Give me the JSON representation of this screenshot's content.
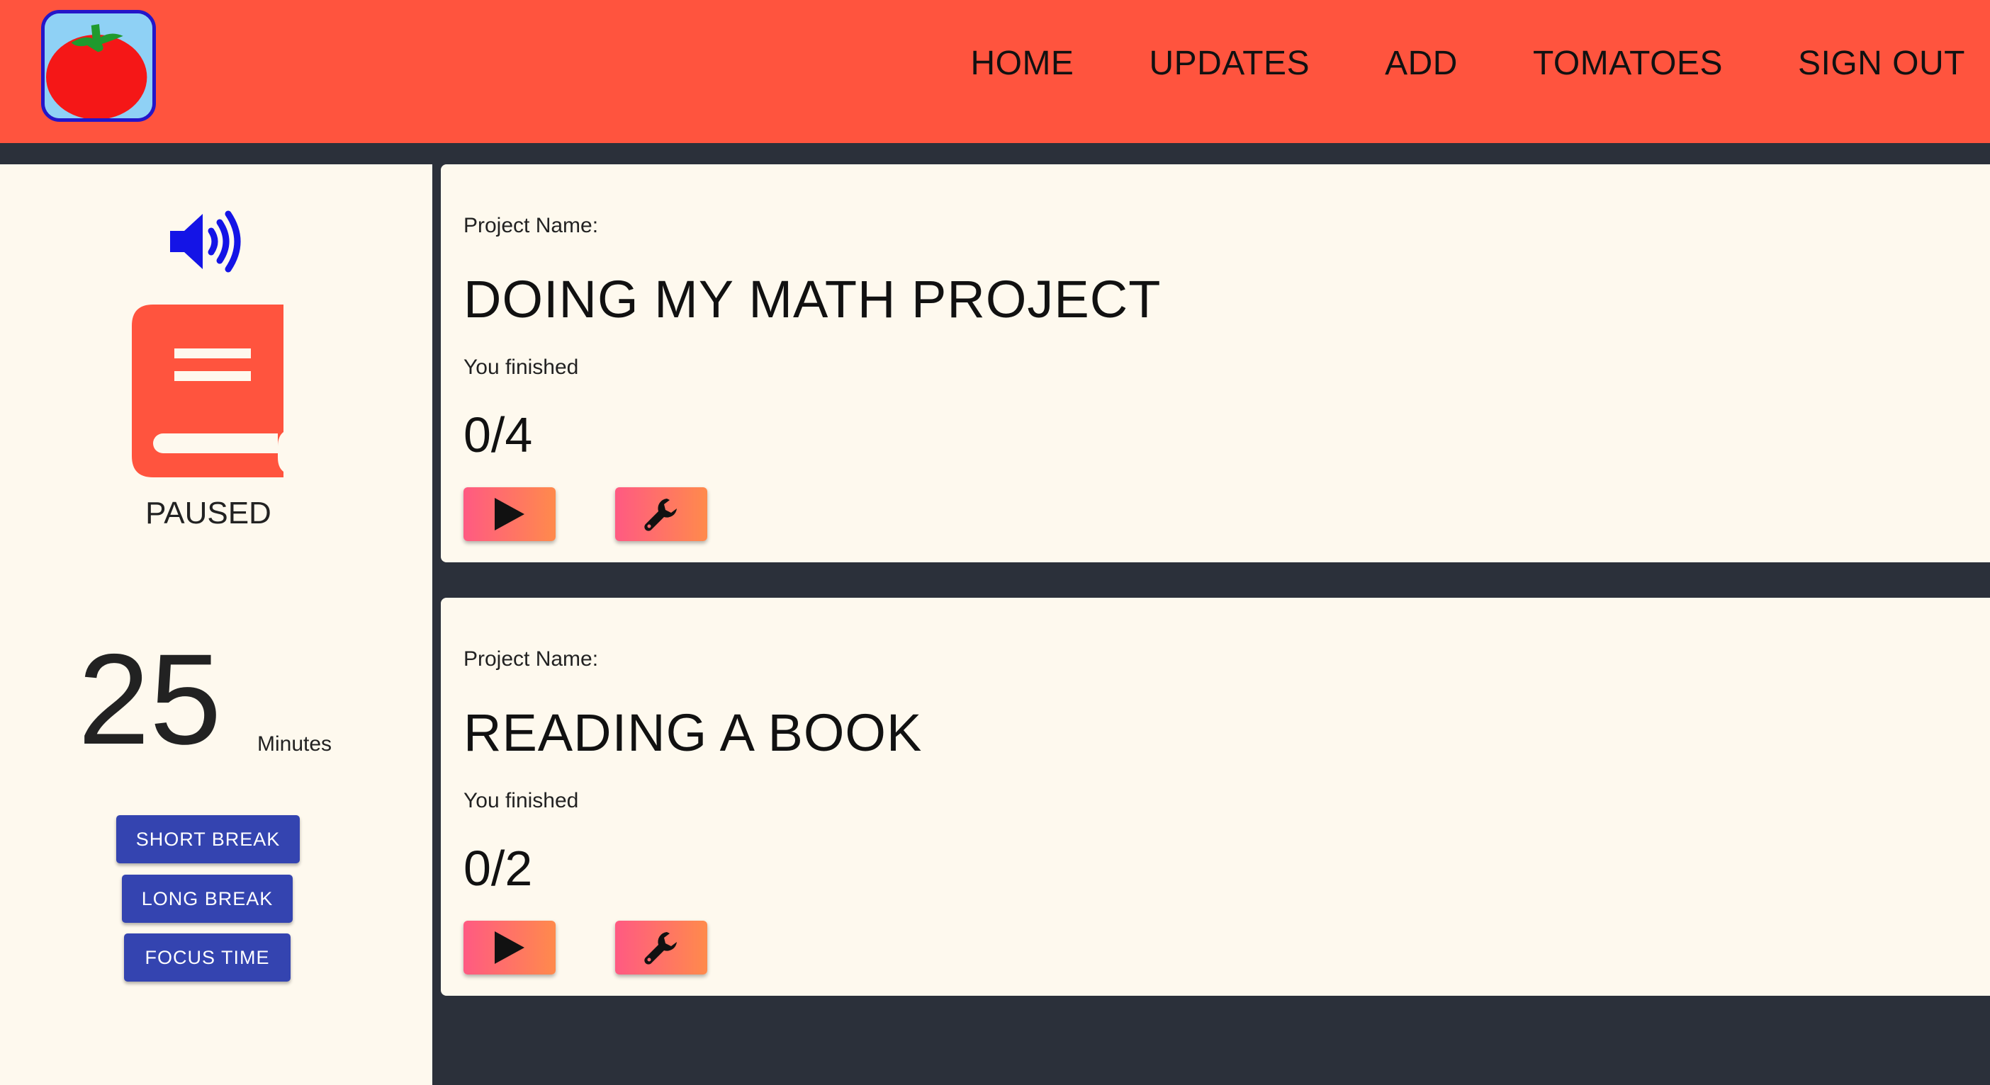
{
  "nav": {
    "logo_icon": "tomato-logo",
    "links": [
      "HOME",
      "UPDATES",
      "ADD",
      "TOMATOES",
      "SIGN OUT"
    ]
  },
  "timer": {
    "sound_icon": "speaker-volume-icon",
    "mode_icon": "book-icon",
    "status": "PAUSED",
    "minutes": "25",
    "unit": "Minutes",
    "buttons": {
      "short_break": "SHORT BREAK",
      "long_break": "LONG BREAK",
      "focus_time": "FOCUS TIME"
    }
  },
  "projects": [
    {
      "name_label": "Project Name:",
      "name": "DOING MY MATH PROJECT",
      "finished_label": "You finished",
      "progress": "0/4",
      "play_icon": "play-icon",
      "settings_icon": "wrench-icon"
    },
    {
      "name_label": "Project Name:",
      "name": "READING A BOOK",
      "finished_label": "You finished",
      "progress": "0/2",
      "play_icon": "play-icon",
      "settings_icon": "wrench-icon"
    }
  ],
  "colors": {
    "navbar": "#ff543e",
    "background": "#2b303a",
    "panel": "#fef9ee",
    "mode_button": "#3444b0",
    "accent_gradient_start": "#ff5a82",
    "accent_gradient_end": "#ff8a4c",
    "speaker": "#1414e6",
    "book": "#ff543e"
  }
}
